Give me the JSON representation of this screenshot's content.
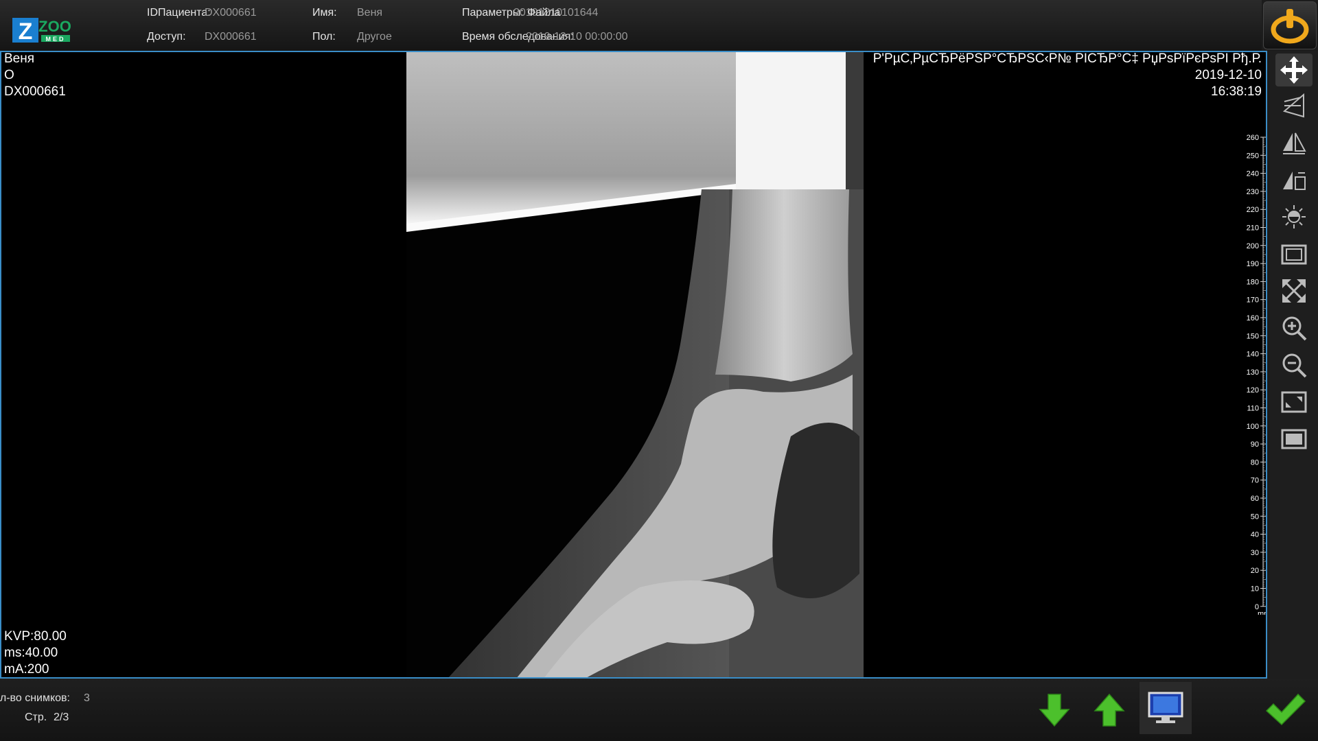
{
  "header": {
    "logo_text": "ZOO",
    "logo_sub": "MED",
    "patient_id_label": "IDПациента:",
    "patient_id_value": "DX000661",
    "name_label": "Имя:",
    "name_value": "Веня",
    "params_label": "Параметры:",
    "params_value": "20191210",
    "params_overlap_label": "Файла",
    "params_overlap_value": "101644",
    "access_label": "Доступ:",
    "access_value": "DX000661",
    "sex_label": "Пол:",
    "sex_value": "Другое",
    "exam_time_label": "Время обследования:",
    "exam_time_value": "2019-12-10 00:00:00"
  },
  "viewer": {
    "overlay_top_left": [
      "Веня",
      "O",
      "DX000661"
    ],
    "overlay_top_right": [
      "Р'РµС‚РµСЂРёРЅР°СЂРЅС‹Р№ РІСЂР°С‡ РџРѕРїРєРѕРІ Рђ.Р.",
      "2019-12-10",
      "16:38:19"
    ],
    "overlay_bottom_left": [
      "KVP:80.00",
      "ms:40.00",
      "mA:200"
    ],
    "ruler_ticks": [
      "260",
      "250",
      "240",
      "230",
      "220",
      "210",
      "200",
      "190",
      "180",
      "170",
      "160",
      "150",
      "140",
      "130",
      "120",
      "110",
      "100",
      "90",
      "80",
      "70",
      "60",
      "50",
      "40",
      "30",
      "20",
      "10",
      "0"
    ],
    "ruler_unit": "mm"
  },
  "toolbar": {
    "tools": [
      "move-icon",
      "rotate-icon",
      "flip-vertical-icon",
      "flip-horizontal-icon",
      "brightness-icon",
      "frame-icon",
      "fit-icon",
      "zoom-in-icon",
      "zoom-out-icon",
      "fullscreen-icon",
      "window-icon"
    ]
  },
  "footer": {
    "count_label": "Кол-во снимков:",
    "count_value": "3",
    "page_label": "Стр.",
    "page_value": "2/3"
  },
  "colors": {
    "accent": "#3a8ec8",
    "green": "#4cc02c",
    "power": "#f0a81c"
  }
}
